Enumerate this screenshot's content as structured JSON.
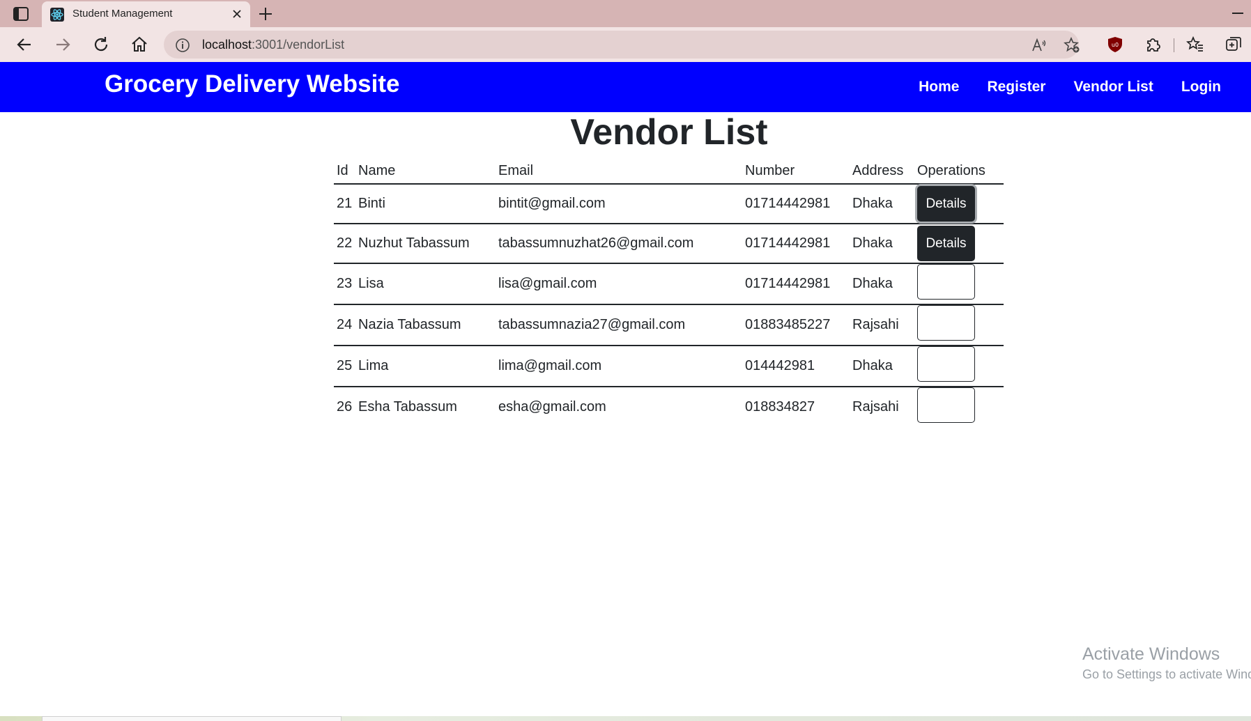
{
  "browser": {
    "tab_title": "Student Management",
    "url_host": "localhost",
    "url_path": ":3001/vendorList"
  },
  "navbar": {
    "brand": "Grocery Delivery Website",
    "links": [
      "Home",
      "Register",
      "Vendor List",
      "Login"
    ]
  },
  "page": {
    "title": "Vendor List"
  },
  "table": {
    "headers": [
      "Id",
      "Name",
      "Email",
      "Number",
      "Address",
      "Operations"
    ],
    "rows": [
      {
        "id": "21",
        "name": "Binti",
        "email": "bintit@gmail.com",
        "number": "01714442981",
        "address": "Dhaka",
        "operation": "Details"
      },
      {
        "id": "22",
        "name": "Nuzhut Tabassum",
        "email": "tabassumnuzhat26@gmail.com",
        "number": "01714442981",
        "address": "Dhaka",
        "operation": "Details"
      },
      {
        "id": "23",
        "name": "Lisa",
        "email": "lisa@gmail.com",
        "number": "01714442981",
        "address": "Dhaka",
        "operation": ""
      },
      {
        "id": "24",
        "name": "Nazia Tabassum",
        "email": "tabassumnazia27@gmail.com",
        "number": "01883485227",
        "address": "Rajsahi",
        "operation": ""
      },
      {
        "id": "25",
        "name": "Lima",
        "email": "lima@gmail.com",
        "number": "014442981",
        "address": "Dhaka",
        "operation": ""
      },
      {
        "id": "26",
        "name": "Esha Tabassum",
        "email": "esha@gmail.com",
        "number": "018834827",
        "address": "Rajsahi",
        "operation": ""
      }
    ]
  },
  "watermark": {
    "title": "Activate Windows",
    "subtitle": "Go to Settings to activate Windows."
  },
  "colors": {
    "navbar_bg": "#0000ff",
    "tabstrip_bg": "#d6b4b4",
    "toolbar_bg": "#f2e4e4",
    "button_dark": "#212529"
  }
}
